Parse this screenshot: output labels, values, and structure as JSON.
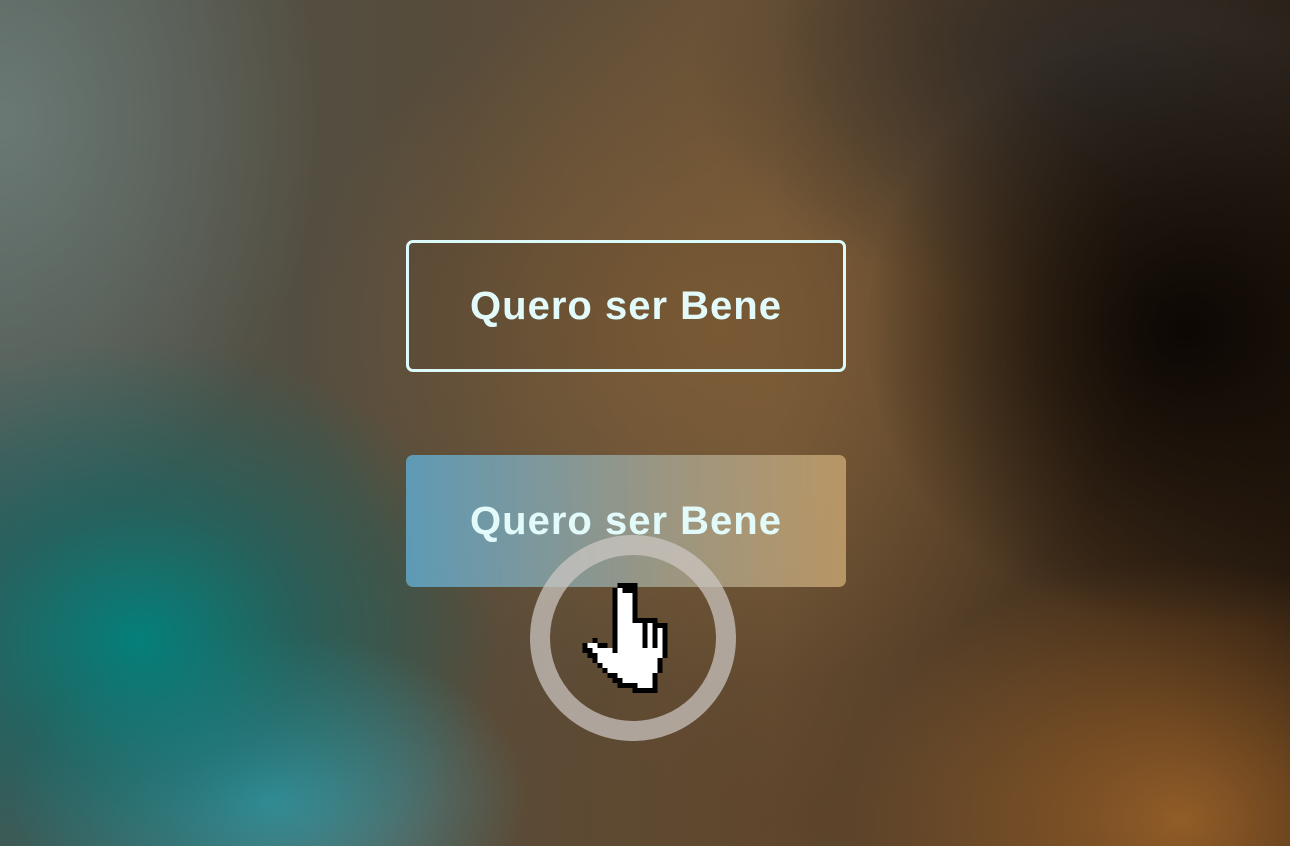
{
  "buttons": {
    "outline_label": "Quero ser Bene",
    "filled_label": "Quero ser Bene"
  },
  "colors": {
    "label_text": "#e2fbfa",
    "outline_border": "#dcfafa",
    "filled_gradient_start": "#5f9ebc",
    "filled_gradient_end": "#be9b69",
    "click_ring": "#cdc8c3"
  },
  "cursor": {
    "icon": "hand-pointer-icon",
    "state": "click"
  }
}
